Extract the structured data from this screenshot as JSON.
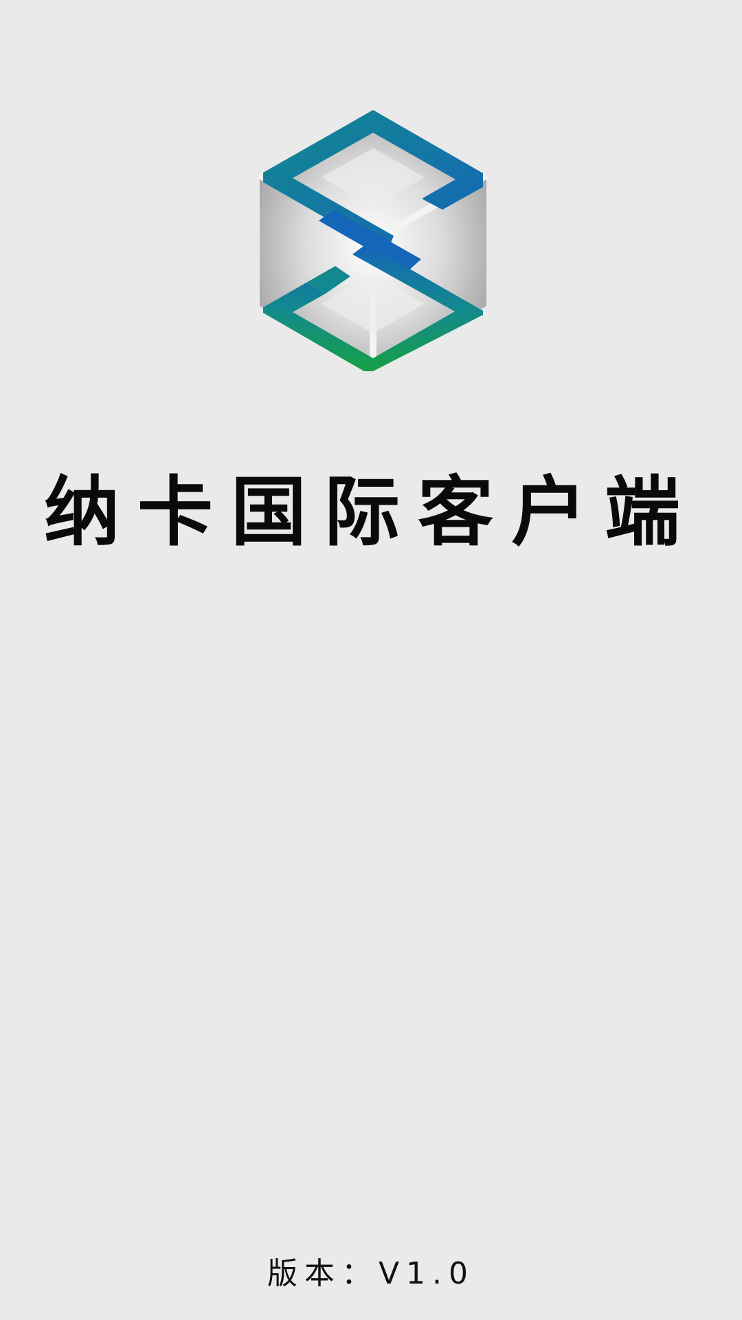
{
  "splash": {
    "logo_icon": "hexagon-s-logo-icon",
    "title": "纳卡国际客户端",
    "version_label": "版本：V1.0"
  },
  "colors": {
    "background": "#eaeaea",
    "logo_blue": "#1565b8",
    "logo_teal": "#12898f",
    "logo_green": "#17a046",
    "logo_gray": "#bdbdbd",
    "text": "#0a0a0a"
  }
}
